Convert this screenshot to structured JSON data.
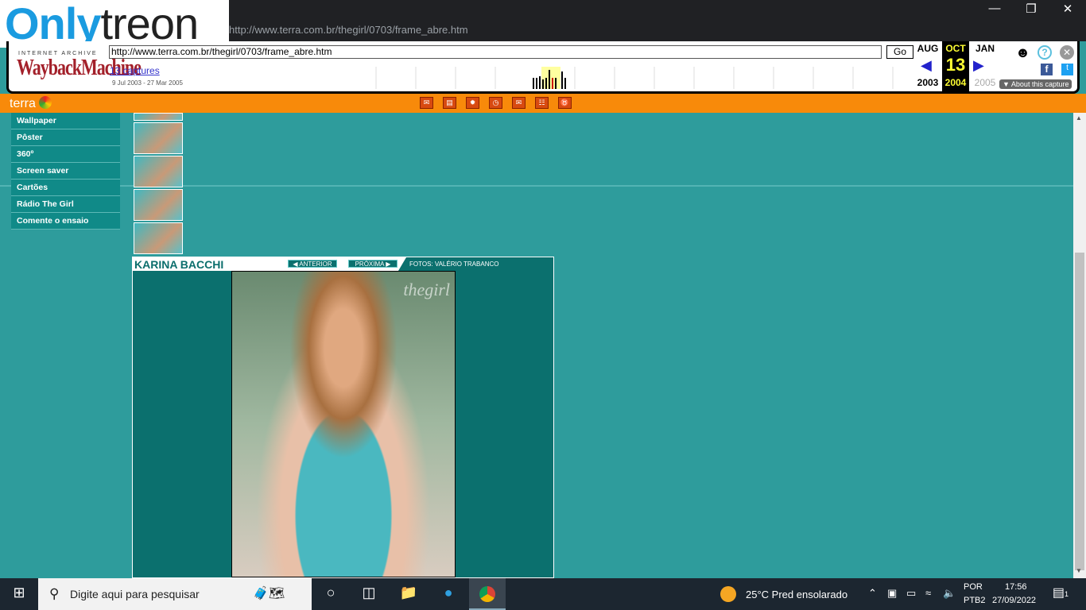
{
  "browser": {
    "address": "http://www.terra.com.br/thegirl/0703/frame_abre.htm",
    "watermark_logo": "Onlytreon"
  },
  "wayback": {
    "logo_top": "INTERNET ARCHIVE",
    "logo_main": "WaybackMachine",
    "url": "http://www.terra.com.br/thegirl/0703/frame_abre.htm",
    "go": "Go",
    "captures": "13 captures",
    "range": "9 Jul 2003 - 27 Mar 2005",
    "prev_month": "AUG",
    "prev_year": "2003",
    "cur_month": "OCT",
    "cur_day": "13",
    "cur_year": "2004",
    "next_month": "JAN",
    "next_year": "2005",
    "about": "About this capture"
  },
  "terra": {
    "logo": "terra"
  },
  "menu": [
    "Wallpaper",
    "Pôster",
    "360º",
    "Screen saver",
    "Cartões",
    "Rádio The Girl",
    "Comente o ensaio"
  ],
  "gallery": {
    "name": "KARINA BACCHI",
    "prev": "ANTERIOR",
    "next": "PRÓXIMA",
    "credit": "FOTOS: VALÉRIO TRABANCO",
    "photo_watermark": "thegirl"
  },
  "taskbar": {
    "search_placeholder": "Digite aqui para pesquisar",
    "weather": "25°C  Pred ensolarado",
    "lang1": "POR",
    "lang2": "PTB2",
    "time": "17:56",
    "date": "27/09/2022",
    "notifications": "1"
  }
}
